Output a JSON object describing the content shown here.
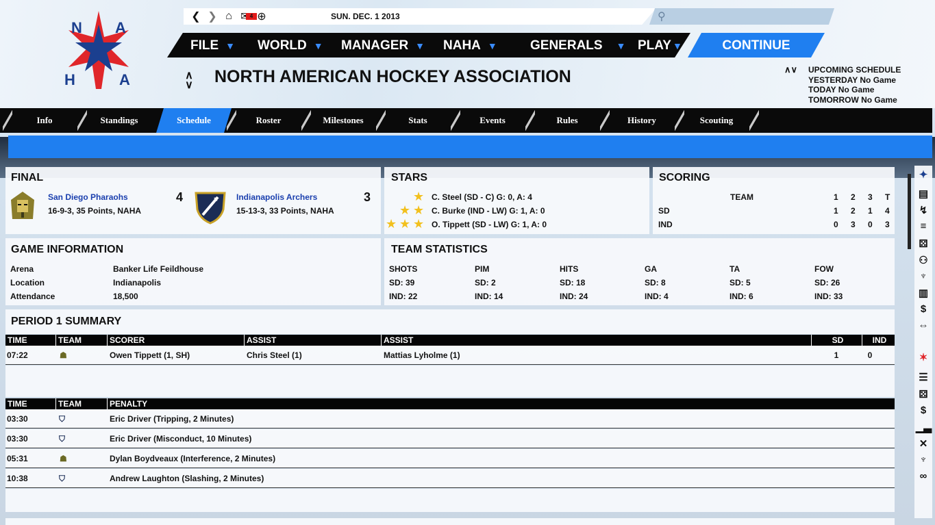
{
  "nav": {
    "back_icon": "chevron-left-icon",
    "forward_icon": "chevron-right-icon",
    "home_icon": "home-icon",
    "mail_icon": "mail-icon",
    "mail_count": "4",
    "globe_icon": "globe-icon",
    "date": "SUN. DEC. 1 2013",
    "search_placeholder": ""
  },
  "logo": {
    "letters": [
      "N",
      "A",
      "H",
      "A"
    ]
  },
  "menu": {
    "items": [
      {
        "label": "FILE"
      },
      {
        "label": "WORLD"
      },
      {
        "label": "MANAGER"
      },
      {
        "label": "NAHA"
      },
      {
        "label": "GENERALS"
      },
      {
        "label": "PLAY"
      }
    ],
    "arrow": "▼",
    "continue_label": "CONTINUE"
  },
  "header": {
    "title": "NORTH AMERICAN HOCKEY ASSOCIATION",
    "sort_arrows": "∧∨"
  },
  "upcoming": {
    "title": "UPCOMING SCHEDULE",
    "lines": [
      "YESTERDAY No Game",
      "TODAY No Game",
      "TOMORROW No Game"
    ]
  },
  "tabs": [
    "Info",
    "Standings",
    "Schedule",
    "Roster",
    "Milestones",
    "Stats",
    "Events",
    "Rules",
    "History",
    "Scouting"
  ],
  "active_tab": "Schedule",
  "final": {
    "heading": "FINAL",
    "home": {
      "name": "San Diego Pharaohs",
      "record": "16-9-3, 35 Points, NAHA",
      "score": "4"
    },
    "away": {
      "name": "Indianapolis Archers",
      "record": "15-13-3, 33 Points, NAHA",
      "score": "3"
    }
  },
  "stars": {
    "heading": "STARS",
    "items": [
      {
        "count": 1,
        "text": "C. Steel (SD - C)  G: 0,  A: 4"
      },
      {
        "count": 2,
        "text": "C. Burke (IND - LW)  G: 1,  A: 0"
      },
      {
        "count": 3,
        "text": "O. Tippett (SD - LW)  G: 1,  A: 0"
      }
    ],
    "star_glyph": "★"
  },
  "scoring": {
    "heading": "SCORING",
    "columns": [
      "TEAM",
      "1",
      "2",
      "3",
      "T"
    ],
    "rows": [
      {
        "team": "SD",
        "p": [
          "1",
          "2",
          "1",
          "4"
        ]
      },
      {
        "team": "IND",
        "p": [
          "0",
          "3",
          "0",
          "3"
        ]
      }
    ]
  },
  "game_info": {
    "heading": "GAME INFORMATION",
    "rows": [
      {
        "label": "Arena",
        "value": "Banker Life Feildhouse"
      },
      {
        "label": "Location",
        "value": "Indianapolis"
      },
      {
        "label": "Attendance",
        "value": "18,500"
      }
    ]
  },
  "team_stats": {
    "heading": "TEAM STATISTICS",
    "cols": [
      {
        "label": "SHOTS",
        "sd": "SD: 39",
        "ind": "IND: 22"
      },
      {
        "label": "PIM",
        "sd": "SD: 2",
        "ind": "IND: 14"
      },
      {
        "label": "HITS",
        "sd": "SD: 18",
        "ind": "IND: 24"
      },
      {
        "label": "GA",
        "sd": "SD: 8",
        "ind": "IND: 4"
      },
      {
        "label": "TA",
        "sd": "SD: 5",
        "ind": "IND: 6"
      },
      {
        "label": "FOW",
        "sd": "SD: 26",
        "ind": "IND: 33"
      }
    ]
  },
  "period": {
    "heading": "PERIOD 1 SUMMARY",
    "goal_headers": [
      "TIME",
      "TEAM",
      "SCORER",
      "ASSIST",
      "ASSIST",
      "SD",
      "IND"
    ],
    "goals": [
      {
        "time": "07:22",
        "team": "SD",
        "scorer": "Owen Tippett (1, SH)",
        "assist1": "Chris Steel (1)",
        "assist2": "Mattias Lyholme (1)",
        "sd": "1",
        "ind": "0"
      }
    ],
    "penalty_headers": [
      "TIME",
      "TEAM",
      "PENALTY"
    ],
    "penalties": [
      {
        "time": "03:30",
        "team": "IND",
        "text": "Eric Driver (Tripping, 2 Minutes)"
      },
      {
        "time": "03:30",
        "team": "IND",
        "text": "Eric Driver (Misconduct, 10 Minutes)"
      },
      {
        "time": "05:31",
        "team": "SD",
        "text": "Dylan Boydveaux (Interference, 2 Minutes)"
      },
      {
        "time": "10:38",
        "team": "IND",
        "text": "Andrew Laughton (Slashing, 2 Minutes)"
      }
    ]
  },
  "sidebar_icons": [
    "team-logo-icon",
    "clipboard-icon",
    "tactics-icon",
    "list-icon",
    "dice-icon",
    "staff-icon",
    "trophy-icon",
    "document-icon",
    "finance-icon",
    "trade-icon",
    "league-logo-icon",
    "list-icon",
    "dice-icon",
    "dollar-icon",
    "bar-chart-icon",
    "sticks-icon",
    "trophy-icon",
    "binoculars-icon"
  ],
  "colors": {
    "accent": "#1f7ff0",
    "link": "#1a3fae",
    "star": "#f2c01d",
    "badge": "#e21b1b"
  }
}
